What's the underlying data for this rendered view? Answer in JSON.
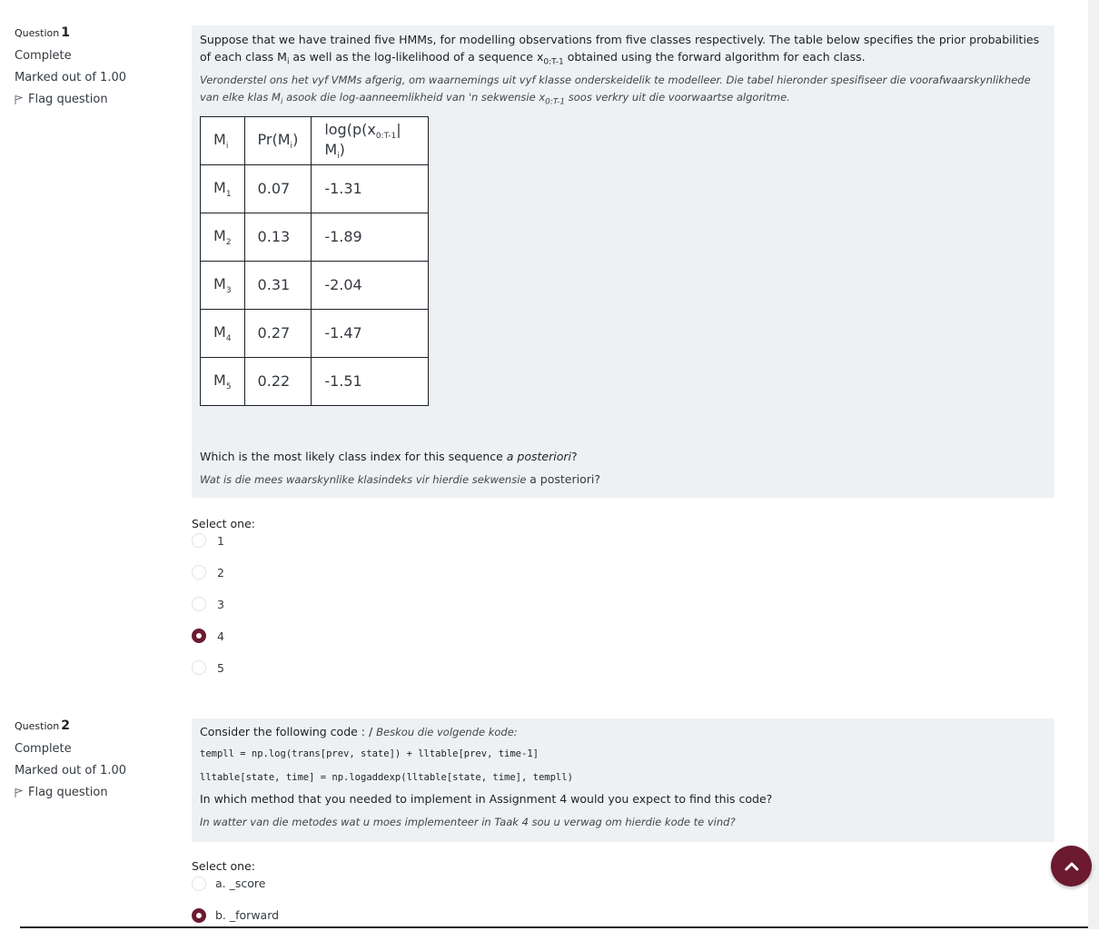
{
  "q1": {
    "number_prefix": "Question",
    "number": "1",
    "state": "Complete",
    "grade": "Marked out of 1.00",
    "flag_label": "Flag question",
    "text_en_1": "Suppose that we have trained five HMMs, for modelling observations from five classes respectively. The table below specifies the prior probabilities of each class M",
    "text_en_2": " as well as the log-likelihood of a sequence x",
    "text_en_3": " obtained using the forward algorithm for each class.",
    "text_af_1": "Veronderstel ons het vyf VMMs afgerig, om waarnemings uit vyf klasse onderskeidelik te modelleer.  Die tabel hieronder spesifiseer die voorafwaarskynlikhede van elke klas M",
    "text_af_2": " asook die log-aanneemlikheid van 'n sekwensie x",
    "text_af_3": " soos verkry uit die voorwaartse algoritme.",
    "sub_i": "i",
    "sub_seq": "0:T-1",
    "table": {
      "header": {
        "m": "M",
        "m_sub": "i",
        "pr": "Pr(M",
        "pr_sub": "i",
        "pr_end": ")",
        "ll": "log(p(x",
        "ll_sub": "0:T-1",
        "ll_mid": "| M",
        "ll_sub2": "i",
        "ll_end": ")"
      },
      "rows": [
        {
          "m": "M",
          "sub": "1",
          "pr": "0.07",
          "ll": "-1.31"
        },
        {
          "m": "M",
          "sub": "2",
          "pr": "0.13",
          "ll": "-1.89"
        },
        {
          "m": "M",
          "sub": "3",
          "pr": "0.31",
          "ll": "-2.04"
        },
        {
          "m": "M",
          "sub": "4",
          "pr": "0.27",
          "ll": "-1.47"
        },
        {
          "m": "M",
          "sub": "5",
          "pr": "0.22",
          "ll": "-1.51"
        }
      ]
    },
    "question_en": "Which is the most likely class index for this sequence ",
    "question_en_italic": "a posteriori",
    "question_en_end": "?",
    "question_af": "Wat is die mees waarskynlike klasindeks vir hierdie sekwensie ",
    "question_af_plain": "a posteriori?",
    "select_one": "Select one:",
    "options": [
      "1",
      "2",
      "3",
      "4",
      "5"
    ],
    "selected": "4"
  },
  "q2": {
    "number_prefix": "Question",
    "number": "2",
    "state": "Complete",
    "grade": "Marked out of 1.00",
    "flag_label": "Flag question",
    "intro_en": "Consider the following code : / ",
    "intro_af": "Beskou die volgende kode:",
    "code_line_1": "templl = np.log(trans[prev, state]) + lltable[prev, time-1]",
    "code_line_2": "lltable[state, time] = np.logaddexp(lltable[state, time], templl)",
    "question_en": "In which method that you needed to implement in Assignment 4 would you expect to find this code?",
    "question_af": "In watter van die metodes wat u moes implementeer in Taak 4 sou u verwag om hierdie kode te vind?",
    "select_one": "Select one:",
    "options": [
      "a. _score",
      "b. _forward"
    ],
    "selected": "b. _forward"
  },
  "colors": {
    "accent": "#6b1a2f",
    "panel": "#eef1f4"
  },
  "icons": {
    "flag": "flag-icon",
    "back_to_top": "chevron-up-icon"
  }
}
